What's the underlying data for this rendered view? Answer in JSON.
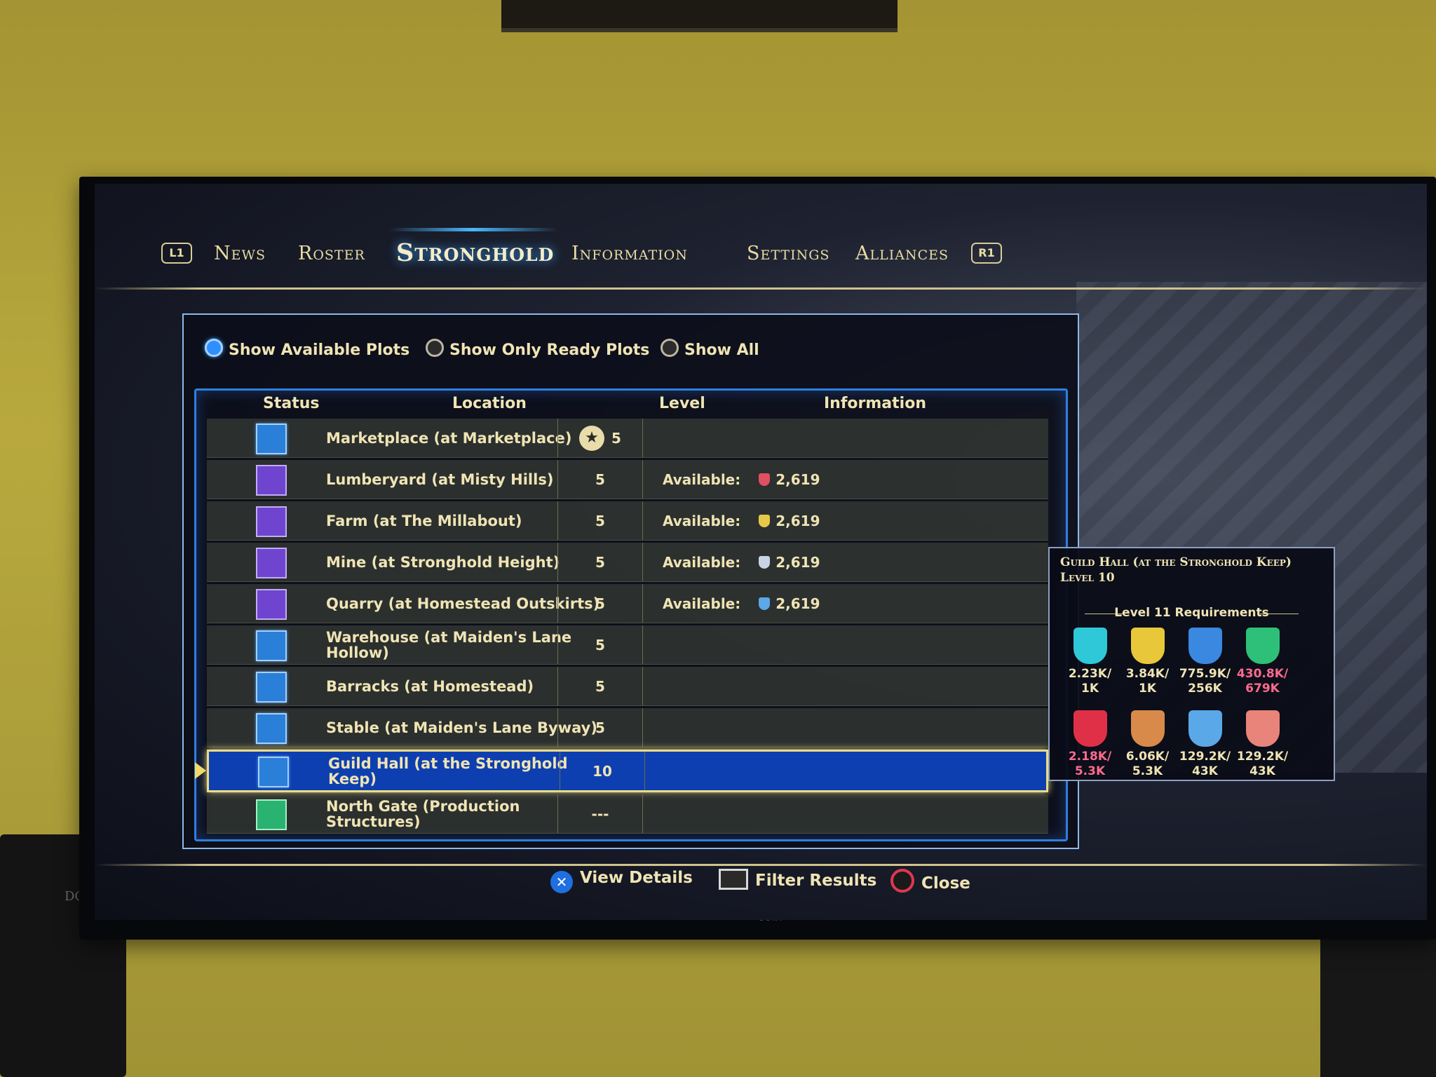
{
  "nav": {
    "left_shoulder": "L1",
    "right_shoulder": "R1",
    "tabs": [
      {
        "label": "News"
      },
      {
        "label": "Roster"
      },
      {
        "label": "Stronghold"
      },
      {
        "label": "Information"
      },
      {
        "label": "Settings"
      },
      {
        "label": "Alliances"
      }
    ],
    "active_tab": "Stronghold"
  },
  "filters": [
    {
      "label": "Show Available Plots",
      "selected": true
    },
    {
      "label": "Show Only Ready Plots",
      "selected": false
    },
    {
      "label": "Show All",
      "selected": false
    }
  ],
  "table": {
    "headers": {
      "status": "Status",
      "location": "Location",
      "level": "Level",
      "information": "Information"
    },
    "rows": [
      {
        "status_icon": "blue-plot-icon",
        "location": "Marketplace (at Marketplace)",
        "level": "5",
        "info_label": "",
        "info_value": "",
        "has_star": true
      },
      {
        "status_icon": "purple-plot-icon",
        "location": "Lumberyard (at Misty Hills)",
        "level": "5",
        "info_label": "Available:",
        "info_value": "2,619",
        "res_color": "#e05060"
      },
      {
        "status_icon": "purple-plot-icon",
        "location": "Farm (at The Millabout)",
        "level": "5",
        "info_label": "Available:",
        "info_value": "2,619",
        "res_color": "#e8c84a"
      },
      {
        "status_icon": "purple-plot-icon",
        "location": "Mine (at Stronghold Height)",
        "level": "5",
        "info_label": "Available:",
        "info_value": "2,619",
        "res_color": "#c8d4e4"
      },
      {
        "status_icon": "purple-plot-icon",
        "location": "Quarry (at Homestead Outskirts)",
        "level": "5",
        "info_label": "Available:",
        "info_value": "2,619",
        "res_color": "#5aa8e8"
      },
      {
        "status_icon": "blue-plot-icon",
        "location": "Warehouse (at Maiden's Lane Hollow)",
        "level": "5",
        "info_label": "",
        "info_value": ""
      },
      {
        "status_icon": "blue-plot-icon",
        "location": "Barracks (at Homestead)",
        "level": "5",
        "info_label": "",
        "info_value": ""
      },
      {
        "status_icon": "blue-plot-icon",
        "location": "Stable (at Maiden's Lane Byway)",
        "level": "5",
        "info_label": "",
        "info_value": ""
      },
      {
        "status_icon": "blue-plot-icon",
        "location": "Guild Hall (at the Stronghold Keep)",
        "level": "10",
        "info_label": "",
        "info_value": "",
        "selected": true
      },
      {
        "status_icon": "green-gate-icon",
        "location": "North Gate (Production Structures)",
        "level": "---",
        "info_label": "",
        "info_value": ""
      }
    ]
  },
  "tooltip": {
    "title": "Guild Hall (at the Stronghold Keep)",
    "level": "Level 10",
    "requirements_title": "Level 11 Requirements",
    "resources": [
      {
        "icon": "cyan-banner-icon",
        "color": "#2fc8d8",
        "have": "2.23K/",
        "need": "1K",
        "met": true
      },
      {
        "icon": "gold-banner-icon",
        "color": "#e8c83a",
        "have": "3.84K/",
        "need": "1K",
        "met": true
      },
      {
        "icon": "blue-banner-icon",
        "color": "#3a88e0",
        "have": "775.9K/",
        "need": "256K",
        "met": true
      },
      {
        "icon": "green-banner-icon",
        "color": "#2ec078",
        "have": "430.8K/",
        "need": "679K",
        "met": false
      },
      {
        "icon": "red-banner-icon",
        "color": "#e03048",
        "have": "2.18K/",
        "need": "5.3K",
        "met": false
      },
      {
        "icon": "orange-banner-icon",
        "color": "#d88a4a",
        "have": "6.06K/",
        "need": "5.3K",
        "met": true
      },
      {
        "icon": "light-blue-banner-icon",
        "color": "#5aa8e8",
        "have": "129.2K/",
        "need": "43K",
        "met": true
      },
      {
        "icon": "salmon-banner-icon",
        "color": "#e8847a",
        "have": "129.2K/",
        "need": "43K",
        "met": true
      }
    ]
  },
  "footer": {
    "view_details": "View Details",
    "filter_results": "Filter Results",
    "close": "Close"
  },
  "room": {
    "speaker_brand": "DCM",
    "tv_brand": "SONY"
  }
}
